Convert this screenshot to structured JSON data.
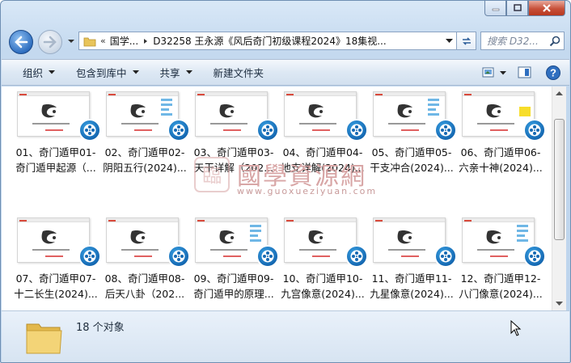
{
  "window": {
    "caption_buttons": [
      "minimize",
      "maximize",
      "close"
    ]
  },
  "address_bar": {
    "overflow": "«",
    "crumbs": [
      "国学...",
      "D32258 王永源《风后奇门初级课程2024》18集视..."
    ],
    "search_placeholder": "搜索 D32..."
  },
  "toolbar": {
    "organize": "组织",
    "include_in_library": "包含到库中",
    "share": "共享",
    "new_folder": "新建文件夹"
  },
  "files": [
    {
      "line1": "01、奇门遁甲01-",
      "line2": "奇门遁甲起源（..."
    },
    {
      "line1": "02、奇门遁甲02-",
      "line2": "阴阳五行(2024)..."
    },
    {
      "line1": "03、奇门遁甲03-",
      "line2": "天干详解（202..."
    },
    {
      "line1": "04、奇门遁甲04-",
      "line2": "地支详解(2024)..."
    },
    {
      "line1": "05、奇门遁甲05-",
      "line2": "干支冲合(2024)..."
    },
    {
      "line1": "06、奇门遁甲06-",
      "line2": "六亲十神(2024)..."
    },
    {
      "line1": "07、奇门遁甲07-",
      "line2": "十二长生(2024)..."
    },
    {
      "line1": "08、奇门遁甲08-",
      "line2": "后天八卦（202..."
    },
    {
      "line1": "09、奇门遁甲09-",
      "line2": "奇门遁甲的原理..."
    },
    {
      "line1": "10、奇门遁甲10-",
      "line2": "九宫像意(2024)..."
    },
    {
      "line1": "11、奇门遁甲11-",
      "line2": "九星像意(2024)..."
    },
    {
      "line1": "12、奇门遁甲12-",
      "line2": "八门像意(2024)..."
    }
  ],
  "watermark": {
    "title": "國學資源網",
    "url": "www.guoxueziyuan.com"
  },
  "details_pane": {
    "count": "18 个对象"
  },
  "colors": {
    "badge": "#1569b3",
    "accent": "#2f6fc0"
  }
}
